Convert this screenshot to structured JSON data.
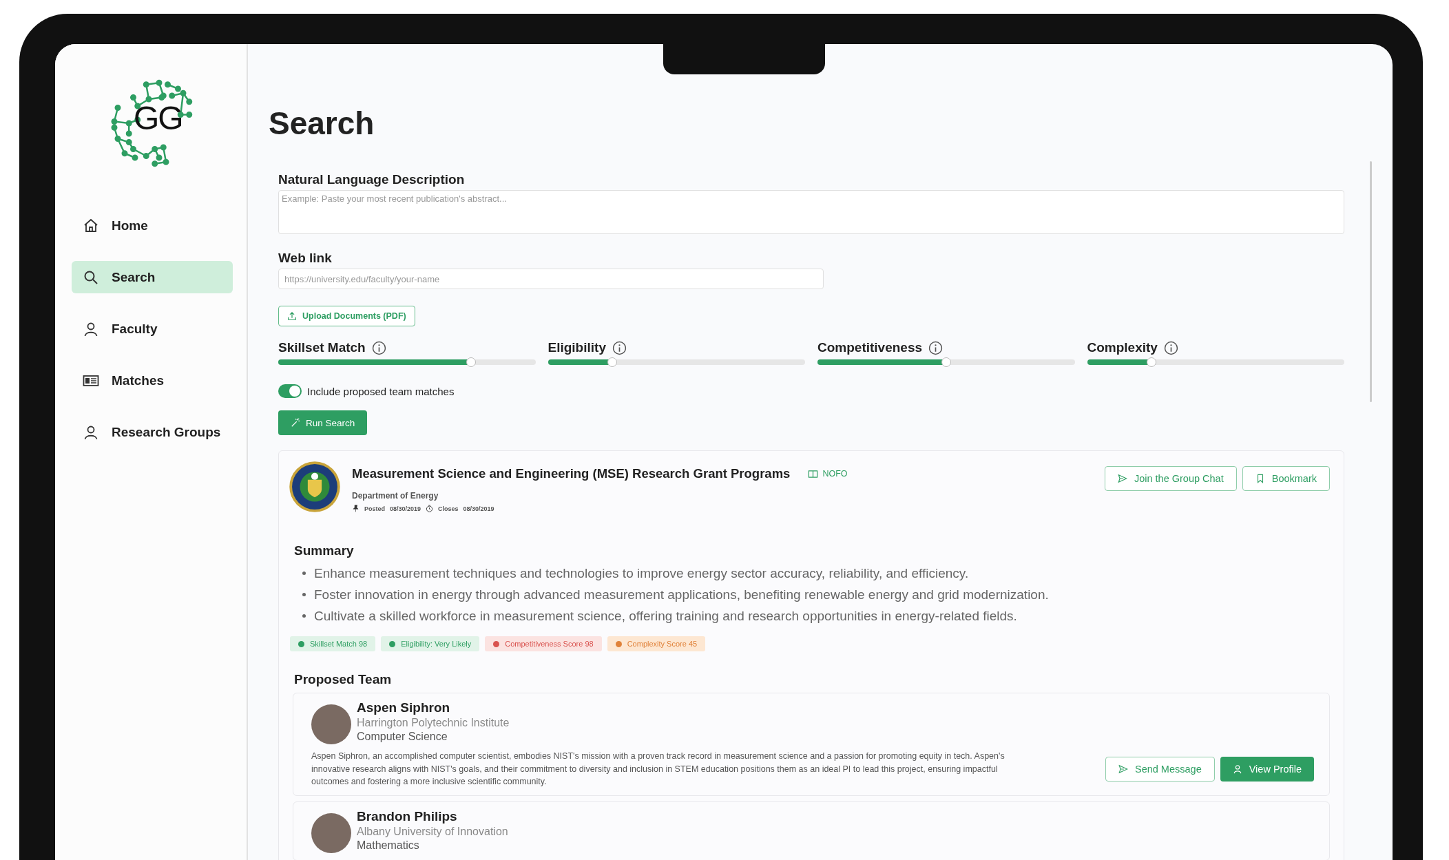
{
  "sidebar": {
    "logo_text": "GG",
    "items": [
      {
        "label": "Home",
        "kind": "home",
        "selected": false
      },
      {
        "label": "Search",
        "kind": "search",
        "selected": true
      },
      {
        "label": "Faculty",
        "kind": "person",
        "selected": false
      },
      {
        "label": "Matches",
        "kind": "card",
        "selected": false
      },
      {
        "label": "Research Groups",
        "kind": "person",
        "selected": false
      }
    ]
  },
  "page_title": "Search",
  "form": {
    "description": {
      "label": "Natural Language Description",
      "placeholder": "Example: Paste your most recent publication's abstract..."
    },
    "web_link": {
      "label": "Web link",
      "placeholder": "https://university.edu/faculty/your-name"
    },
    "upload_button": "Upload Documents (PDF)",
    "sliders": [
      {
        "label": "Skillset Match",
        "level": 0.75
      },
      {
        "label": "Eligibility",
        "level": 0.25
      },
      {
        "label": "Competitiveness",
        "level": 0.5
      },
      {
        "label": "Complexity",
        "level": 0.25
      }
    ],
    "toggle": {
      "label": "Include proposed team matches",
      "on": true
    },
    "run_button": "Run Search"
  },
  "result": {
    "title": "Measurement Science and Engineering (MSE) Research Grant Programs",
    "tag": "NOFO",
    "agency": "Department of Energy",
    "posted_label": "Posted",
    "posted": "08/30/2019",
    "closes_label": "Closes",
    "closes": "08/30/2019",
    "buttons": [
      {
        "label": "Join the Group Chat",
        "kind": "send"
      },
      {
        "label": "Bookmark",
        "kind": "bookmark"
      }
    ],
    "summary_title": "Summary",
    "summary": [
      "Enhance measurement techniques and technologies to improve energy sector accuracy, reliability, and efficiency.",
      "Foster innovation in energy through advanced measurement applications, benefiting renewable energy and grid modernization.",
      "Cultivate a skilled workforce in measurement science, offering training and research opportunities in energy-related fields."
    ],
    "badges": [
      {
        "label": "Skillset Match 98",
        "kind": "skillset",
        "color": "#2e9e62"
      },
      {
        "label": "Eligibility: Very Likely",
        "kind": "eligibility",
        "color": "#2e9e62"
      },
      {
        "label": "Competitiveness Score 98",
        "kind": "competitiveness",
        "color": "#d9534f"
      },
      {
        "label": "Complexity Score 45",
        "kind": "complexity",
        "color": "#e0823a"
      }
    ],
    "team_title": "Proposed Team",
    "team": [
      {
        "name": "Aspen Siphron",
        "institution": "Harrington Polytechnic Institute",
        "department": "Computer Science",
        "bio": "Aspen Siphron, an accomplished computer scientist, embodies NIST's mission with a proven track record in measurement science and a passion for promoting equity in tech. Aspen's innovative research aligns with NIST's goals, and their commitment to diversity and inclusion in STEM education positions them as an ideal PI to lead this project, ensuring impactful outcomes and fostering a more inclusive scientific community.",
        "send_button": "Send Message",
        "profile_button": "View Profile"
      },
      {
        "name": "Brandon Philips",
        "institution": "Albany University of Innovation",
        "department": "Mathematics"
      }
    ]
  }
}
